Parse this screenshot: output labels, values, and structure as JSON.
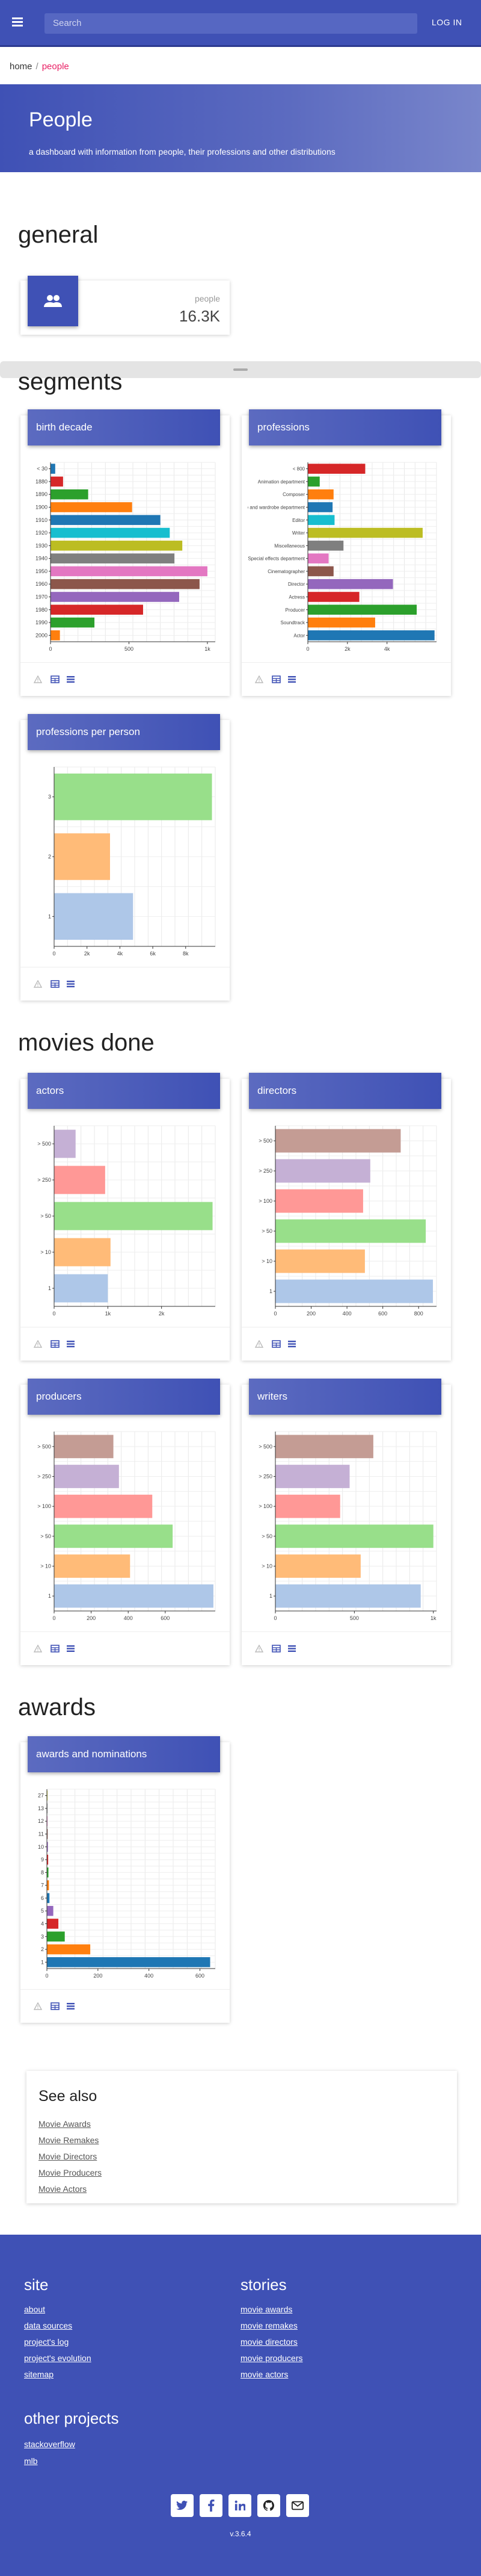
{
  "header": {
    "search_placeholder": "Search",
    "login_label": "LOG IN"
  },
  "breadcrumb": {
    "home": "home",
    "sep": "/",
    "current": "people"
  },
  "hero": {
    "title": "People",
    "subtitle": "a dashboard with information from people, their professions and other distributions"
  },
  "sections": {
    "general": "general",
    "segments": "segments",
    "movies": "movies done",
    "awards": "awards"
  },
  "stat": {
    "label": "people",
    "value": "16.3K",
    "icon": "people-icon"
  },
  "cards": {
    "birth": "birth decade",
    "professions": "professions",
    "ppp": "professions per person",
    "actors": "actors",
    "directors": "directors",
    "producers": "producers",
    "writers": "writers",
    "awards": "awards and nominations"
  },
  "chart_data": [
    {
      "id": "birth",
      "type": "bar",
      "orientation": "horizontal",
      "title": "birth decade",
      "categories": [
        "< 30",
        "1880",
        "1890",
        "1900",
        "1910",
        "1920",
        "1930",
        "1940",
        "1950",
        "1960",
        "1970",
        "1980",
        "1990",
        "2000"
      ],
      "values": [
        30,
        80,
        240,
        520,
        700,
        760,
        840,
        790,
        1000,
        950,
        820,
        590,
        280,
        60
      ],
      "colors": [
        "#1f77b4",
        "#d62728",
        "#2ca02c",
        "#ff7f0e",
        "#1f77b4",
        "#17becf",
        "#bcbd22",
        "#7f7f7f",
        "#e377c2",
        "#8c564b",
        "#9467bd",
        "#d62728",
        "#2ca02c",
        "#ff7f0e"
      ],
      "ticks": [
        [
          0,
          "0"
        ],
        [
          500,
          "500"
        ],
        [
          1000,
          "1k"
        ]
      ],
      "xmax": 1050,
      "grid": true
    },
    {
      "id": "professions",
      "type": "bar",
      "orientation": "horizontal",
      "title": "professions",
      "categories": [
        "< 800",
        "Animation department",
        "Composer",
        "Costume and wardrobe department",
        "Editor",
        "Writer",
        "Miscellaneous",
        "Special effects department",
        "Cinematographer",
        "Director",
        "Actress",
        "Producer",
        "Soundtrack",
        "Actor"
      ],
      "values": [
        2900,
        600,
        1300,
        1250,
        1350,
        5800,
        1800,
        1050,
        1300,
        4300,
        2600,
        5500,
        3400,
        6400
      ],
      "colors": [
        "#d62728",
        "#2ca02c",
        "#ff7f0e",
        "#1f77b4",
        "#17becf",
        "#bcbd22",
        "#7f7f7f",
        "#e377c2",
        "#8c564b",
        "#9467bd",
        "#d62728",
        "#2ca02c",
        "#ff7f0e",
        "#1f77b4"
      ],
      "ticks": [
        [
          0,
          "0"
        ],
        [
          2000,
          "2k"
        ],
        [
          4000,
          "4k"
        ]
      ],
      "xmax": 6500,
      "grid": true
    },
    {
      "id": "ppp",
      "type": "bar",
      "orientation": "horizontal",
      "title": "professions per person",
      "categories": [
        "3",
        "2",
        "1"
      ],
      "values": [
        9600,
        3400,
        4800
      ],
      "colors": [
        "#98df8a",
        "#ffbb78",
        "#aec7e8"
      ],
      "ticks": [
        [
          0,
          "0"
        ],
        [
          2000,
          "2k"
        ],
        [
          4000,
          "4k"
        ],
        [
          6000,
          "6k"
        ],
        [
          8000,
          "8k"
        ]
      ],
      "xmax": 9800,
      "grid": true
    },
    {
      "id": "actors",
      "type": "bar",
      "orientation": "horizontal",
      "title": "actors",
      "categories": [
        "> 500",
        "> 250",
        "> 50",
        "> 10",
        "1"
      ],
      "values": [
        400,
        950,
        2950,
        1050,
        1000
      ],
      "colors": [
        "#c5b0d5",
        "#ff9896",
        "#98df8a",
        "#ffbb78",
        "#aec7e8"
      ],
      "ticks": [
        [
          0,
          "0"
        ],
        [
          1000,
          "1k"
        ],
        [
          2000,
          "2k"
        ]
      ],
      "xmax": 3000,
      "grid": true
    },
    {
      "id": "directors",
      "type": "bar",
      "orientation": "horizontal",
      "title": "directors",
      "categories": [
        "> 500",
        "> 250",
        "> 100",
        "> 50",
        "> 10",
        "1"
      ],
      "values": [
        700,
        530,
        490,
        840,
        500,
        880
      ],
      "colors": [
        "#c49c94",
        "#c5b0d5",
        "#ff9896",
        "#98df8a",
        "#ffbb78",
        "#aec7e8"
      ],
      "ticks": [
        [
          0,
          "0"
        ],
        [
          200,
          "200"
        ],
        [
          400,
          "400"
        ],
        [
          600,
          "600"
        ],
        [
          800,
          "800"
        ]
      ],
      "xmax": 900,
      "grid": true
    },
    {
      "id": "producers",
      "type": "bar",
      "orientation": "horizontal",
      "title": "producers",
      "categories": [
        "> 500",
        "> 250",
        "> 100",
        "> 50",
        "> 10",
        "1"
      ],
      "values": [
        320,
        350,
        530,
        640,
        410,
        860
      ],
      "colors": [
        "#c49c94",
        "#c5b0d5",
        "#ff9896",
        "#98df8a",
        "#ffbb78",
        "#aec7e8"
      ],
      "ticks": [
        [
          0,
          "0"
        ],
        [
          200,
          "200"
        ],
        [
          400,
          "400"
        ],
        [
          600,
          "600"
        ]
      ],
      "xmax": 870,
      "grid": true
    },
    {
      "id": "writers",
      "type": "bar",
      "orientation": "horizontal",
      "title": "writers",
      "categories": [
        "> 500",
        "> 250",
        "> 100",
        "> 50",
        "> 10",
        "1"
      ],
      "values": [
        620,
        470,
        410,
        1000,
        540,
        920
      ],
      "colors": [
        "#c49c94",
        "#c5b0d5",
        "#ff9896",
        "#98df8a",
        "#ffbb78",
        "#aec7e8"
      ],
      "ticks": [
        [
          0,
          "0"
        ],
        [
          500,
          "500"
        ],
        [
          1000,
          "1k"
        ]
      ],
      "xmax": 1020,
      "grid": true
    },
    {
      "id": "awards",
      "type": "bar",
      "orientation": "horizontal",
      "title": "awards and nominations",
      "categories": [
        "27",
        "13",
        "12",
        "11",
        "10",
        "9",
        "8",
        "7",
        "6",
        "5",
        "4",
        "3",
        "2",
        "1"
      ],
      "values": [
        2,
        2,
        2,
        3,
        4,
        5,
        6,
        8,
        10,
        25,
        45,
        70,
        170,
        640
      ],
      "colors": [
        "#bcbd22",
        "#7f7f7f",
        "#e377c2",
        "#8c564b",
        "#9467bd",
        "#d62728",
        "#2ca02c",
        "#ff7f0e",
        "#1f77b4",
        "#9467bd",
        "#d62728",
        "#2ca02c",
        "#ff7f0e",
        "#1f77b4"
      ],
      "ticks": [
        [
          0,
          "0"
        ],
        [
          200,
          "200"
        ],
        [
          400,
          "400"
        ],
        [
          600,
          "600"
        ]
      ],
      "xmax": 660,
      "grid": true
    }
  ],
  "seealso": {
    "title": "See also",
    "links": [
      "Movie Awards",
      "Movie Remakes",
      "Movie Directors",
      "Movie Producers",
      "Movie Actors"
    ]
  },
  "footer": {
    "site_title": "site",
    "site_links": [
      "about",
      "data sources",
      "project's log",
      "project's evolution",
      "sitemap"
    ],
    "stories_title": "stories",
    "stories_links": [
      "movie awards",
      "movie remakes",
      "movie directors",
      "movie producers",
      "movie actors"
    ],
    "other_title": "other projects",
    "other_links": [
      "stackoverflow",
      "mlb"
    ],
    "version": "v.3.6.4"
  },
  "social": [
    "twitter-icon",
    "facebook-icon",
    "linkedin-icon",
    "github-icon",
    "email-icon"
  ],
  "colors": {
    "primary": "#3f51b5",
    "accent": "#e91e63"
  }
}
